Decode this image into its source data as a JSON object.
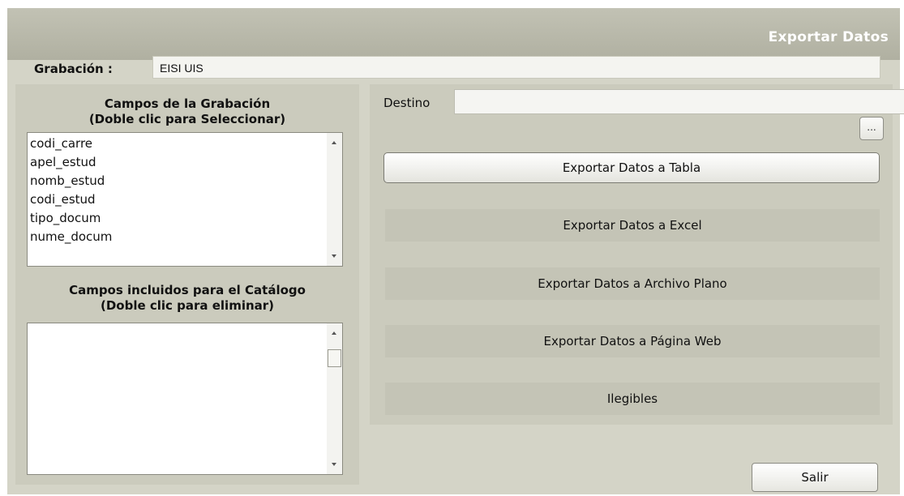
{
  "window": {
    "title": "Exportar Datos"
  },
  "recording": {
    "label": "Grabación :",
    "value": "EISI UIS"
  },
  "fields_panel": {
    "heading_line1": "Campos de la Grabación",
    "heading_line2": "(Doble clic para Seleccionar)",
    "items": [
      "codi_carre",
      "apel_estud",
      "nomb_estud",
      "codi_estud",
      "tipo_docum",
      "nume_docum"
    ]
  },
  "catalog_panel": {
    "heading_line1": "Campos incluidos para el Catálogo",
    "heading_line2": "(Doble clic para eliminar)",
    "items": []
  },
  "destination": {
    "label": "Destino",
    "value": "",
    "browse_label": "..."
  },
  "actions": {
    "export_table": "Exportar Datos a  Tabla",
    "export_excel": "Exportar Datos a Excel",
    "export_flat": "Exportar Datos a Archivo Plano",
    "export_web": "Exportar Datos a Página Web",
    "illegible": "Ilegibles",
    "exit": "Salir"
  }
}
